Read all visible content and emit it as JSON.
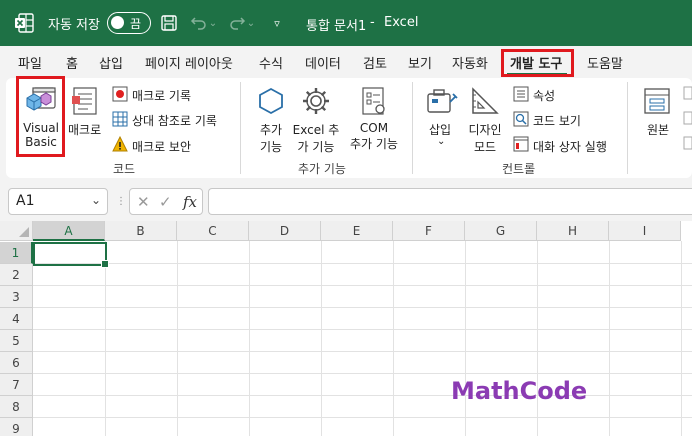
{
  "titlebar": {
    "autosave_label": "자동 저장",
    "autosave_state": "끔",
    "doc_title": "통합 문서1",
    "separator": "-",
    "app_name": "Excel",
    "bg_color": "#1e7145"
  },
  "tabs": [
    {
      "label": "파일"
    },
    {
      "label": "홈"
    },
    {
      "label": "삽입"
    },
    {
      "label": "페이지 레이아웃"
    },
    {
      "label": "수식"
    },
    {
      "label": "데이터"
    },
    {
      "label": "검토"
    },
    {
      "label": "보기"
    },
    {
      "label": "자동화"
    },
    {
      "label": "개발 도구",
      "active": true
    },
    {
      "label": "도움말"
    }
  ],
  "ribbon": {
    "code": {
      "visual_basic_line1": "Visual",
      "visual_basic_line2": "Basic",
      "macro": "매크로",
      "record_macro": "매크로 기록",
      "relative_ref": "상대 참조로 기록",
      "macro_security": "매크로 보안",
      "group": "코드"
    },
    "addins": {
      "addins_line1": "추가",
      "addins_line2": "기능",
      "excel_addins_line1": "Excel 추",
      "excel_addins_line2": "가 기능",
      "com_addins_line1": "COM",
      "com_addins_line2": "추가 기능",
      "group": "추가 기능"
    },
    "controls": {
      "insert": "삽입",
      "design_mode_line1": "디자인",
      "design_mode_line2": "모드",
      "properties": "속성",
      "view_code": "코드 보기",
      "run_dialog": "대화 상자 실행",
      "group": "컨트롤"
    },
    "xml": {
      "source": "원본"
    }
  },
  "formula_bar": {
    "name_box": "A1",
    "fx": "fx",
    "formula": ""
  },
  "grid": {
    "columns": [
      "A",
      "B",
      "C",
      "D",
      "E",
      "F",
      "G",
      "H",
      "I"
    ],
    "rows": [
      "1",
      "2",
      "3",
      "4",
      "5",
      "6",
      "7",
      "8",
      "9"
    ],
    "active_cell": "A1"
  },
  "watermark": "MathCode"
}
